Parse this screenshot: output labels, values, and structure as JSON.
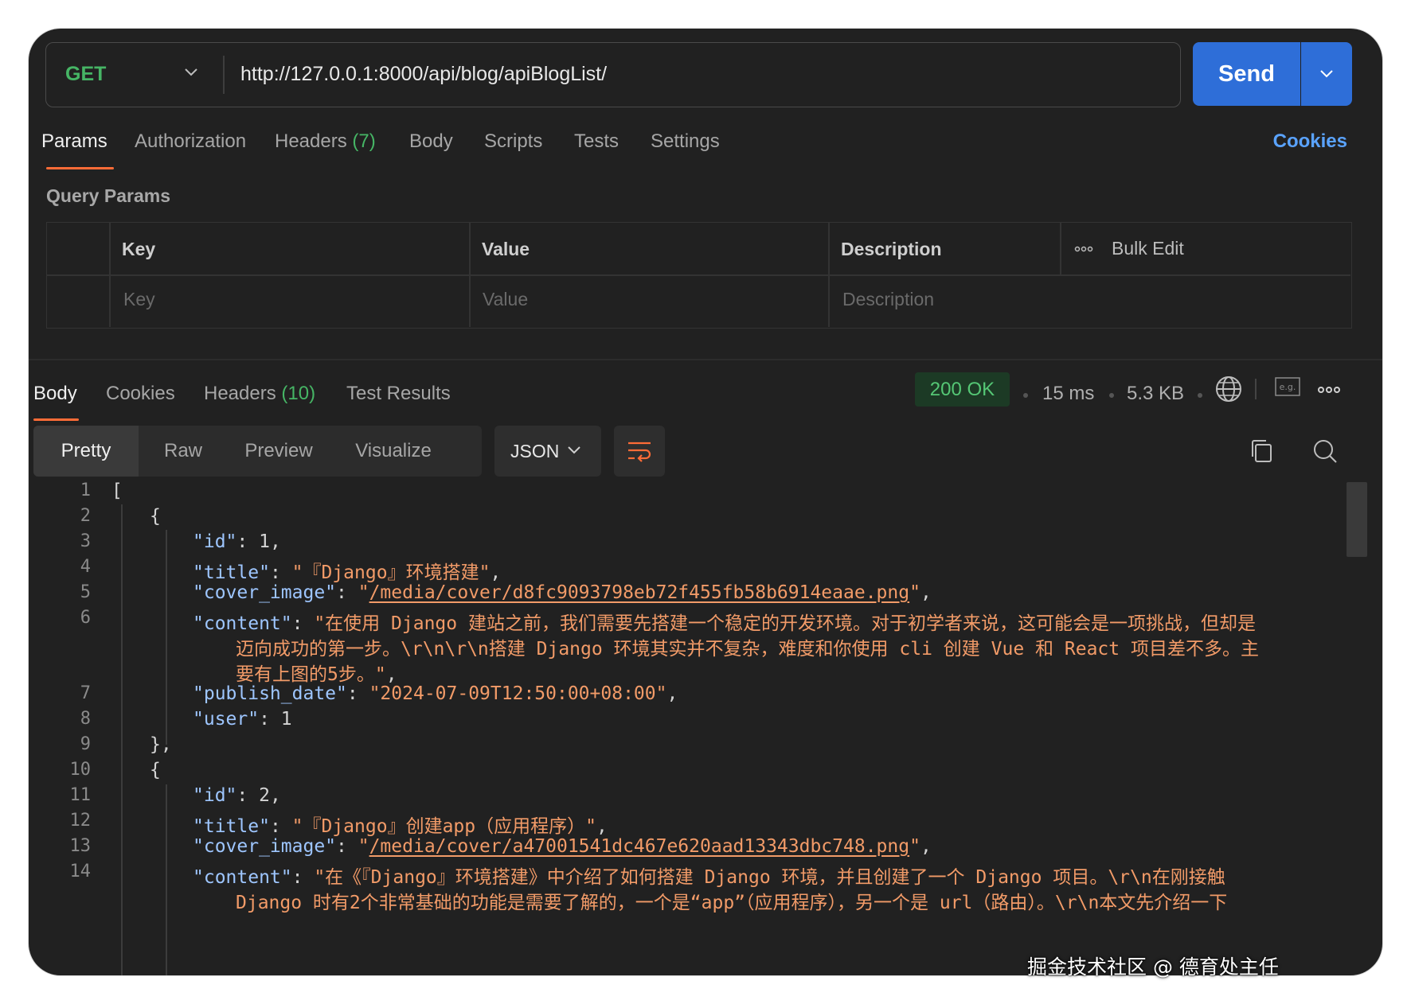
{
  "request": {
    "method": "GET",
    "url": "http://127.0.0.1:8000/api/blog/apiBlogList/",
    "send_label": "Send"
  },
  "request_tabs": [
    {
      "label": "Params",
      "active": true
    },
    {
      "label": "Authorization"
    },
    {
      "label": "Headers",
      "count": "(7)"
    },
    {
      "label": "Body"
    },
    {
      "label": "Scripts"
    },
    {
      "label": "Tests"
    },
    {
      "label": "Settings"
    }
  ],
  "cookies_link": "Cookies",
  "query_params": {
    "title": "Query Params",
    "headers": {
      "key": "Key",
      "value": "Value",
      "description": "Description",
      "bulk_edit": "Bulk Edit"
    },
    "placeholders": {
      "key": "Key",
      "value": "Value",
      "description": "Description"
    }
  },
  "response_tabs": [
    {
      "label": "Body",
      "active": true
    },
    {
      "label": "Cookies"
    },
    {
      "label": "Headers",
      "count": "(10)"
    },
    {
      "label": "Test Results"
    }
  ],
  "response_meta": {
    "status": "200 OK",
    "time": "15 ms",
    "size": "5.3 KB",
    "status_color": "#55c775"
  },
  "view_tabs": [
    "Pretty",
    "Raw",
    "Preview",
    "Visualize"
  ],
  "format": "JSON",
  "icons": [
    "chevron-down-icon",
    "globe-icon",
    "example-icon",
    "more-icon",
    "wrap-lines-icon",
    "copy-icon",
    "search-icon"
  ],
  "code_lines": {
    "1": "[",
    "2": "{",
    "3": {
      "key": "\"id\"",
      "value": "1"
    },
    "4": {
      "key": "\"title\"",
      "value": "\"『Django』环境搭建\""
    },
    "5": {
      "key": "\"cover_image\"",
      "value": "/media/cover/d8fc9093798eb72f455fb58b6914eaae.png"
    },
    "6": {
      "key": "\"content\"",
      "value_line1": "\"在使用 Django 建站之前，我们需要先搭建一个稳定的开发环境。对于初学者来说，这可能会是一项挑战，但却是",
      "value_line2": "迈向成功的第一步。\\r\\n\\r\\n搭建 Django 环境其实并不复杂，难度和你使用 cli 创建 Vue 和 React 项目差不多。主",
      "value_line3": "要有上图的5步。\""
    },
    "7": {
      "key": "\"publish_date\"",
      "value": "\"2024-07-09T12:50:00+08:00\""
    },
    "8": {
      "key": "\"user\"",
      "value": "1"
    },
    "9": "},",
    "10": "{",
    "11": {
      "key": "\"id\"",
      "value": "2"
    },
    "12": {
      "key": "\"title\"",
      "value": "\"『Django』创建app（应用程序）\""
    },
    "13": {
      "key": "\"cover_image\"",
      "value": "/media/cover/a47001541dc467e620aad13343dbc748.png"
    },
    "14": {
      "key": "\"content\"",
      "value_line1": "\"在《『Django』环境搭建》中介绍了如何搭建 Django 环境，并且创建了一个 Django 项目。\\r\\n在刚接触",
      "value_line2": "Django 时有2个非常基础的功能是需要了解的，一个是“app”（应用程序），另一个是 url（路由）。\\r\\n本文先介绍一下"
    }
  },
  "watermark": "掘金技术社区 @ 德育处主任",
  "colors": {
    "accent": "#ff6c37",
    "send": "#2e6ed8",
    "method": "#46b565",
    "link": "#5aa3ff",
    "string": "#f29b68",
    "key": "#9ec6ff"
  }
}
